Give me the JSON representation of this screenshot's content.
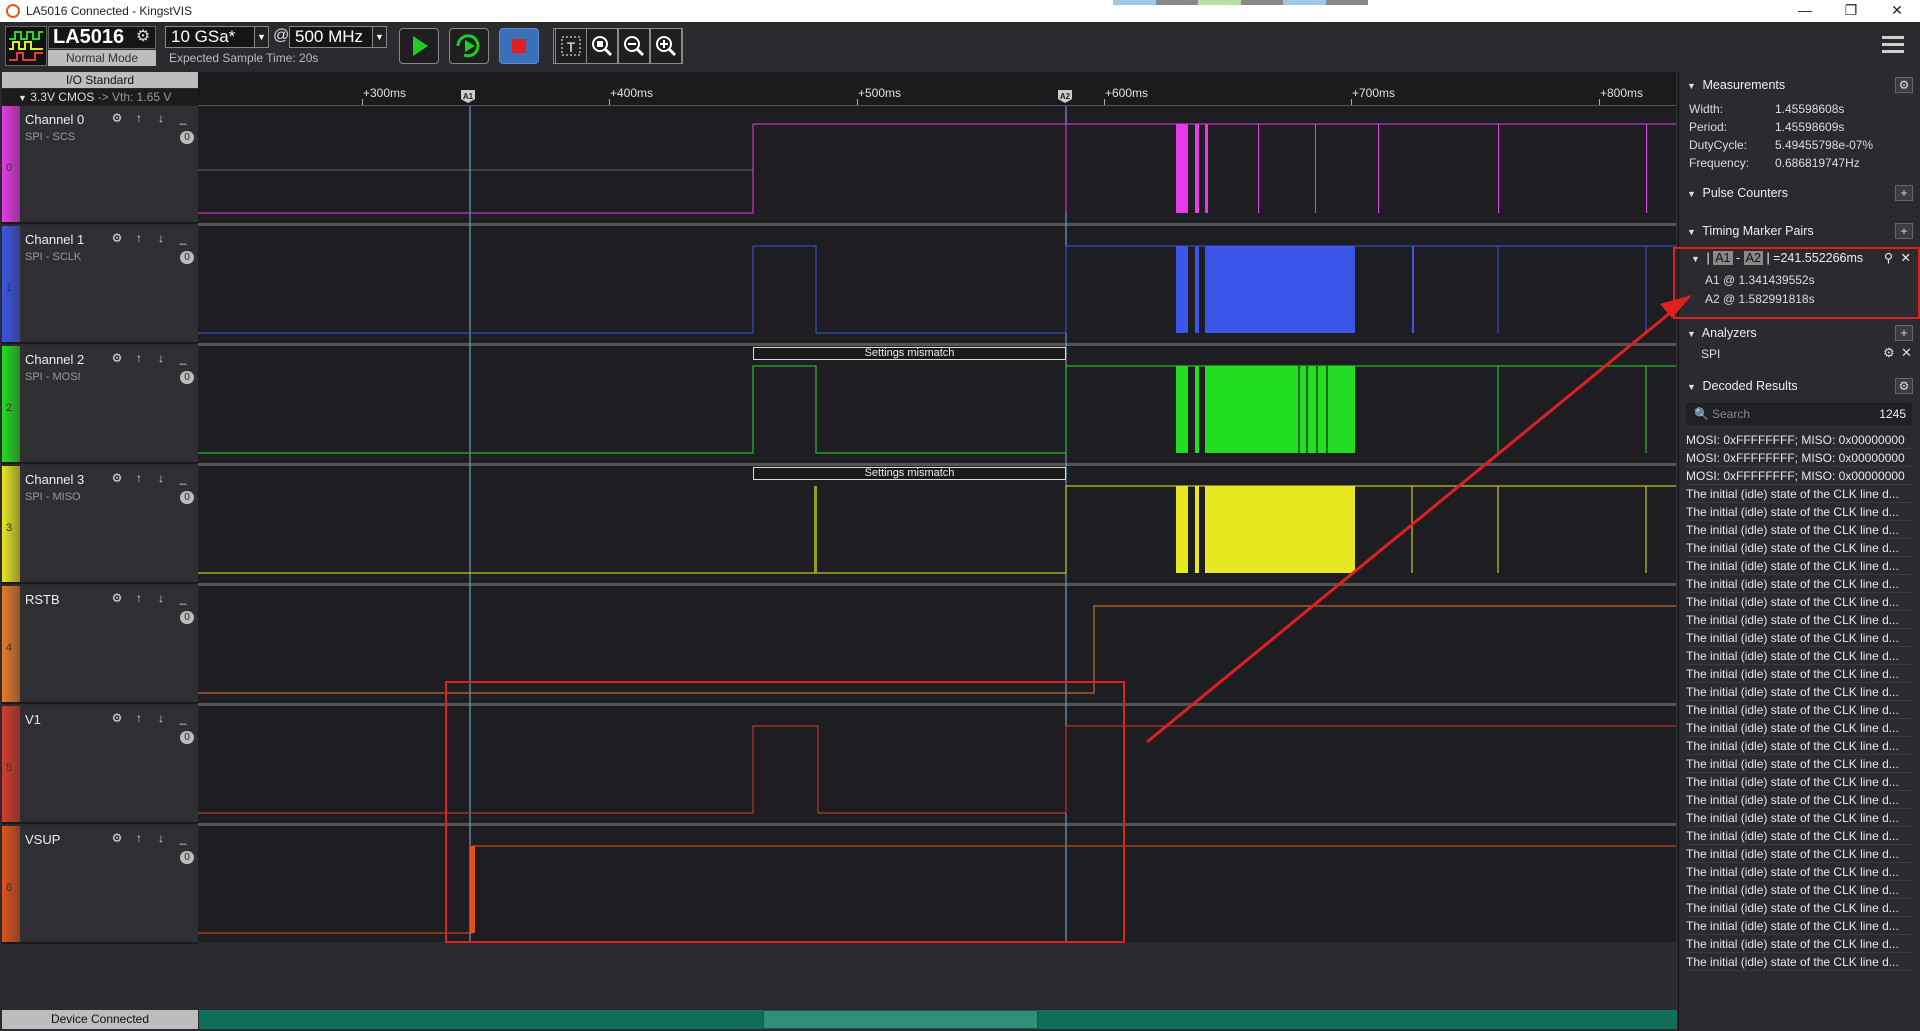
{
  "window": {
    "title": "LA5016 Connected - KingstVIS"
  },
  "device": {
    "name": "LA5016",
    "mode": "Normal Mode",
    "sample_rate": "10 GSa*",
    "at": "@",
    "frequency": "500 MHz",
    "expected": "Expected Sample Time: 20s"
  },
  "io": {
    "standard": "I/O Standard",
    "voltage": "3.3V CMOS",
    "vth": "-> Vth: 1.65 V"
  },
  "ruler": {
    "ticks": [
      "+300ms",
      "+400ms",
      "+500ms",
      "+600ms",
      "+700ms",
      "+800ms"
    ],
    "marker1": "A1",
    "marker2": "A2"
  },
  "channels": [
    {
      "index": "0",
      "name": "Channel 0",
      "protocol": "SPI - SCS",
      "count": "0",
      "color": "#e83ae8"
    },
    {
      "index": "1",
      "name": "Channel 1",
      "protocol": "SPI - SCLK",
      "count": "0",
      "color": "#3a55e8"
    },
    {
      "index": "2",
      "name": "Channel 2",
      "protocol": "SPI - MOSI",
      "count": "0",
      "color": "#22dd22"
    },
    {
      "index": "3",
      "name": "Channel 3",
      "protocol": "SPI - MISO",
      "count": "0",
      "color": "#e8e822"
    },
    {
      "index": "4",
      "name": "RSTB",
      "protocol": "",
      "count": "0",
      "color": "#e87a2a"
    },
    {
      "index": "5",
      "name": "V1",
      "protocol": "",
      "count": "0",
      "color": "#d63a2a"
    },
    {
      "index": "6",
      "name": "VSUP",
      "protocol": "",
      "count": "0",
      "color": "#e0521a"
    }
  ],
  "annotations": {
    "mismatch": "Settings mismatch"
  },
  "status": {
    "device": "Device Connected"
  },
  "measurements": {
    "title": "Measurements",
    "width_label": "Width:",
    "width": "1.45598608s",
    "period_label": "Period:",
    "period": "1.45598609s",
    "duty_label": "DutyCycle:",
    "duty": "5.49455798e-07%",
    "freq_label": "Frequency:",
    "freq": "0.686819747Hz"
  },
  "pulse_counters": {
    "title": "Pulse Counters"
  },
  "timing_pairs": {
    "title": "Timing Marker Pairs",
    "pair_a1": "A1",
    "pair_a2": "A2",
    "pair_value": "=241.552266ms",
    "a1": "A1 @ 1.341439552s",
    "a2": "A2 @ 1.582991818s"
  },
  "analyzers": {
    "title": "Analyzers",
    "item": "SPI"
  },
  "decoded": {
    "title": "Decoded Results",
    "search_placeholder": "Search",
    "count": "1245",
    "rows": [
      "MOSI: 0xFFFFFFFF;  MISO: 0x00000000",
      "MOSI: 0xFFFFFFFF;  MISO: 0x00000000",
      "MOSI: 0xFFFFFFFF;  MISO: 0x00000000",
      "The initial (idle) state of the CLK line d...",
      "The initial (idle) state of the CLK line d...",
      "The initial (idle) state of the CLK line d...",
      "The initial (idle) state of the CLK line d...",
      "The initial (idle) state of the CLK line d...",
      "The initial (idle) state of the CLK line d...",
      "The initial (idle) state of the CLK line d...",
      "The initial (idle) state of the CLK line d...",
      "The initial (idle) state of the CLK line d...",
      "The initial (idle) state of the CLK line d...",
      "The initial (idle) state of the CLK line d...",
      "The initial (idle) state of the CLK line d...",
      "The initial (idle) state of the CLK line d...",
      "The initial (idle) state of the CLK line d...",
      "The initial (idle) state of the CLK line d...",
      "The initial (idle) state of the CLK line d...",
      "The initial (idle) state of the CLK line d...",
      "The initial (idle) state of the CLK line d...",
      "The initial (idle) state of the CLK line d...",
      "The initial (idle) state of the CLK line d...",
      "The initial (idle) state of the CLK line d...",
      "The initial (idle) state of the CLK line d...",
      "The initial (idle) state of the CLK line d...",
      "The initial (idle) state of the CLK line d...",
      "The initial (idle) state of the CLK line d...",
      "The initial (idle) state of the CLK line d...",
      "The initial (idle) state of the CLK line d..."
    ]
  }
}
